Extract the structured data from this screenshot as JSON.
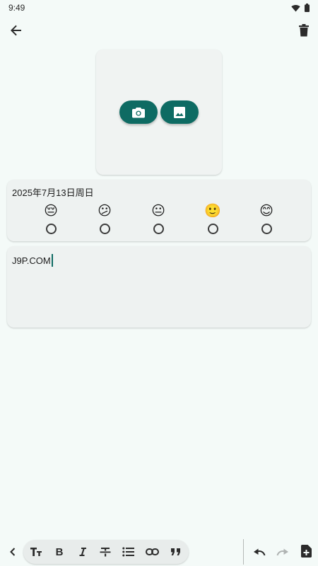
{
  "status_bar": {
    "time": "9:49"
  },
  "entry": {
    "date": "2025年7月13日周日",
    "note_text": "J9P.COM"
  },
  "moods": [
    {
      "emoji": "😔",
      "label": "very-sad"
    },
    {
      "emoji": "😕",
      "label": "sad"
    },
    {
      "emoji": "😐",
      "label": "neutral"
    },
    {
      "emoji": "🙂",
      "label": "happy"
    },
    {
      "emoji": "😊",
      "label": "very-happy"
    }
  ],
  "colors": {
    "accent": "#0e6b63",
    "background": "#f4faf8",
    "card": "#eef2f1"
  },
  "icons": {
    "back": "arrow-left-icon",
    "delete": "trash-icon",
    "camera": "camera-icon",
    "gallery": "image-icon",
    "collapse": "chevron-left-icon",
    "text_size": "text-size-icon",
    "bold": "bold-icon",
    "italic": "italic-icon",
    "strikethrough": "strikethrough-icon",
    "list": "bullet-list-icon",
    "link": "link-icon",
    "quote": "quote-icon",
    "undo": "undo-icon",
    "redo": "redo-icon",
    "add_note": "add-note-icon"
  }
}
